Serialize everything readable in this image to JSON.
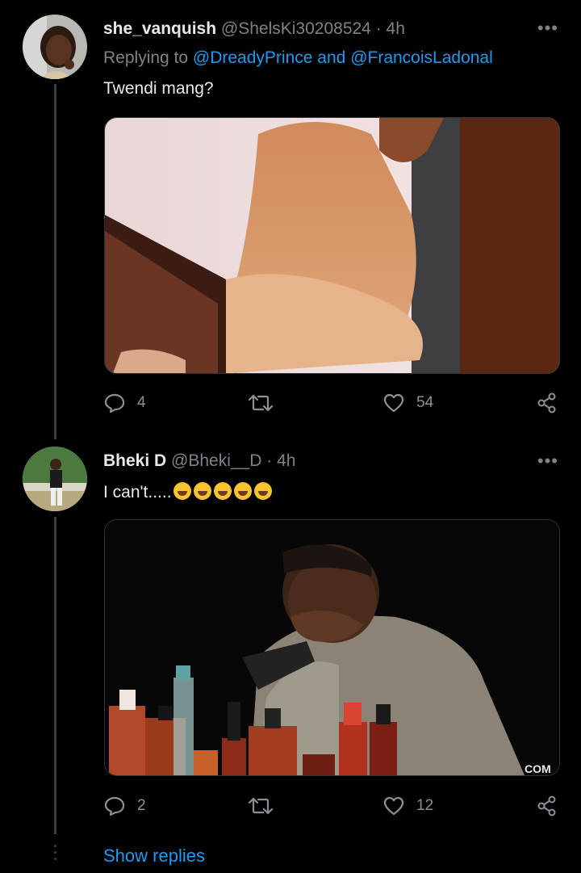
{
  "tweets": [
    {
      "name": "she_vanquish",
      "handle": "@ShelsKi30208524",
      "time": "· 4h",
      "reply_prefix": "Replying to",
      "reply_user1": "@DreadyPrince",
      "reply_and": "and",
      "reply_user2": "@FrancoisLadonal",
      "text": "Twendi mang?",
      "more": "•••",
      "replies": "4",
      "retweets": "",
      "likes": "54"
    },
    {
      "name": "Bheki D",
      "handle": "@Bheki__D",
      "time": "· 4h",
      "text": "I can't.....",
      "emojis": [
        "rofl",
        "rofl",
        "rofl",
        "grin",
        "grin"
      ],
      "more": "•••",
      "replies": "2",
      "retweets": "",
      "likes": "12",
      "watermark": "COM"
    }
  ],
  "show_replies": "Show replies",
  "colors": {
    "accent": "#1d9bf0",
    "muted": "#7d8288",
    "background": "#000000"
  }
}
